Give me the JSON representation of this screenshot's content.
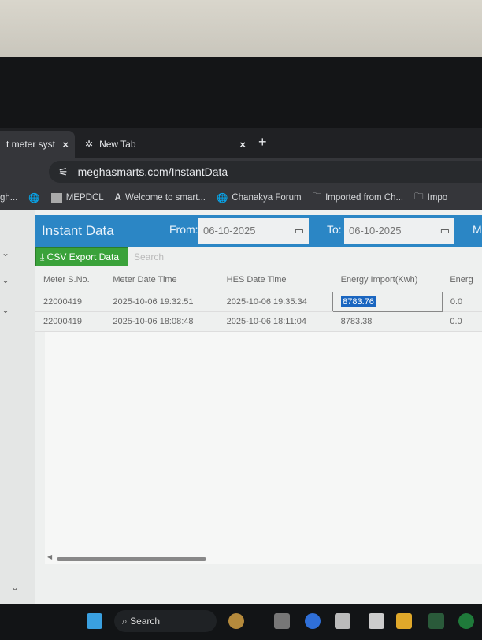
{
  "browser": {
    "tabs": [
      {
        "label": "t meter syst",
        "close": "×"
      },
      {
        "label": "New Tab",
        "close": "×"
      }
    ],
    "new_tab": "+",
    "url": "meghasmarts.com/InstantData",
    "bookmarks": [
      "gh...",
      "MEPDCL",
      "Welcome to smart...",
      "Chanakya Forum",
      "Imported from Ch...",
      "Impo"
    ]
  },
  "page": {
    "title": "Instant Data",
    "from_label": "From:",
    "from_value": "06-10-2025",
    "to_label": "To:",
    "to_value": "06-10-2025",
    "more_label": "M",
    "csv_button": "CSV Export Data",
    "search_placeholder": "Search",
    "columns": [
      "Meter S.No.",
      "Meter Date Time",
      "HES Date Time",
      "Energy Import(Kwh)",
      "Energ"
    ],
    "rows": [
      [
        "22000419",
        "2025-10-06 19:32:51",
        "2025-10-06 19:35:34",
        "8783.76",
        "0.0"
      ],
      [
        "22000419",
        "2025-10-06 18:08:48",
        "2025-10-06 18:11:04",
        "8783.38",
        "0.0"
      ]
    ]
  },
  "taskbar": {
    "search": "Search"
  }
}
